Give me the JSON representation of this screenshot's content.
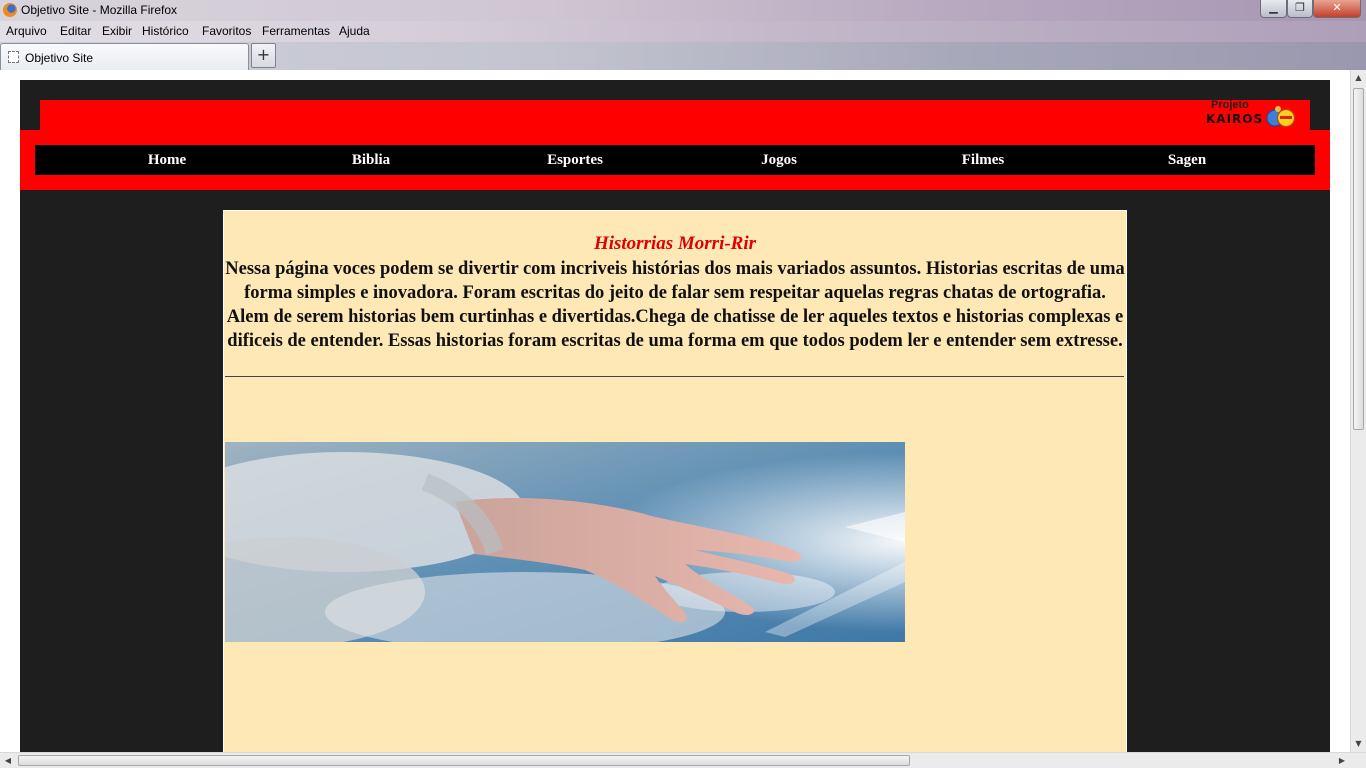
{
  "window": {
    "title": "Objetivo Site - Mozilla Firefox",
    "controls": {
      "minimize": "▁",
      "maximize": "❐",
      "close": "✕"
    }
  },
  "menubar": {
    "items": [
      "Arquivo",
      "Editar",
      "Exibir",
      "Histórico",
      "Favoritos",
      "Ferramentas",
      "Ajuda"
    ]
  },
  "tabs": [
    {
      "label": "Objetivo Site",
      "active": true
    }
  ],
  "new_tab_label": "+",
  "site": {
    "logo": {
      "line1": "Projeto",
      "line2": "KAIROS"
    },
    "nav": [
      "Home",
      "Biblia",
      "Esportes",
      "Jogos",
      "Filmes",
      "Sagen"
    ],
    "content": {
      "title": "Historrias Morri-Rir",
      "body": "Nessa página voces podem se divertir com incriveis histórias dos mais variados assuntos. Historias escritas de uma forma simples e inovadora. Foram escritas do jeito de falar sem respeitar aquelas regras chatas de ortografia. Alem de serem historias bem curtinhas e divertidas.Chega de chatisse de ler aqueles textos e historias complexas e dificeis de entender. Essas historias foram escritas de uma forma em que todos podem ler e entender sem extresse."
    },
    "colors": {
      "header": "#ff0000",
      "nav_bg": "#000000",
      "content_bg": "#fde8b6",
      "title": "#e00000",
      "page_bg": "#1e1e1e"
    }
  },
  "icons": {
    "firefox": "firefox-logo-icon",
    "tab": "page-icon",
    "scroll_up": "▲",
    "scroll_down": "▼",
    "scroll_left": "◀",
    "scroll_right": "▶"
  }
}
